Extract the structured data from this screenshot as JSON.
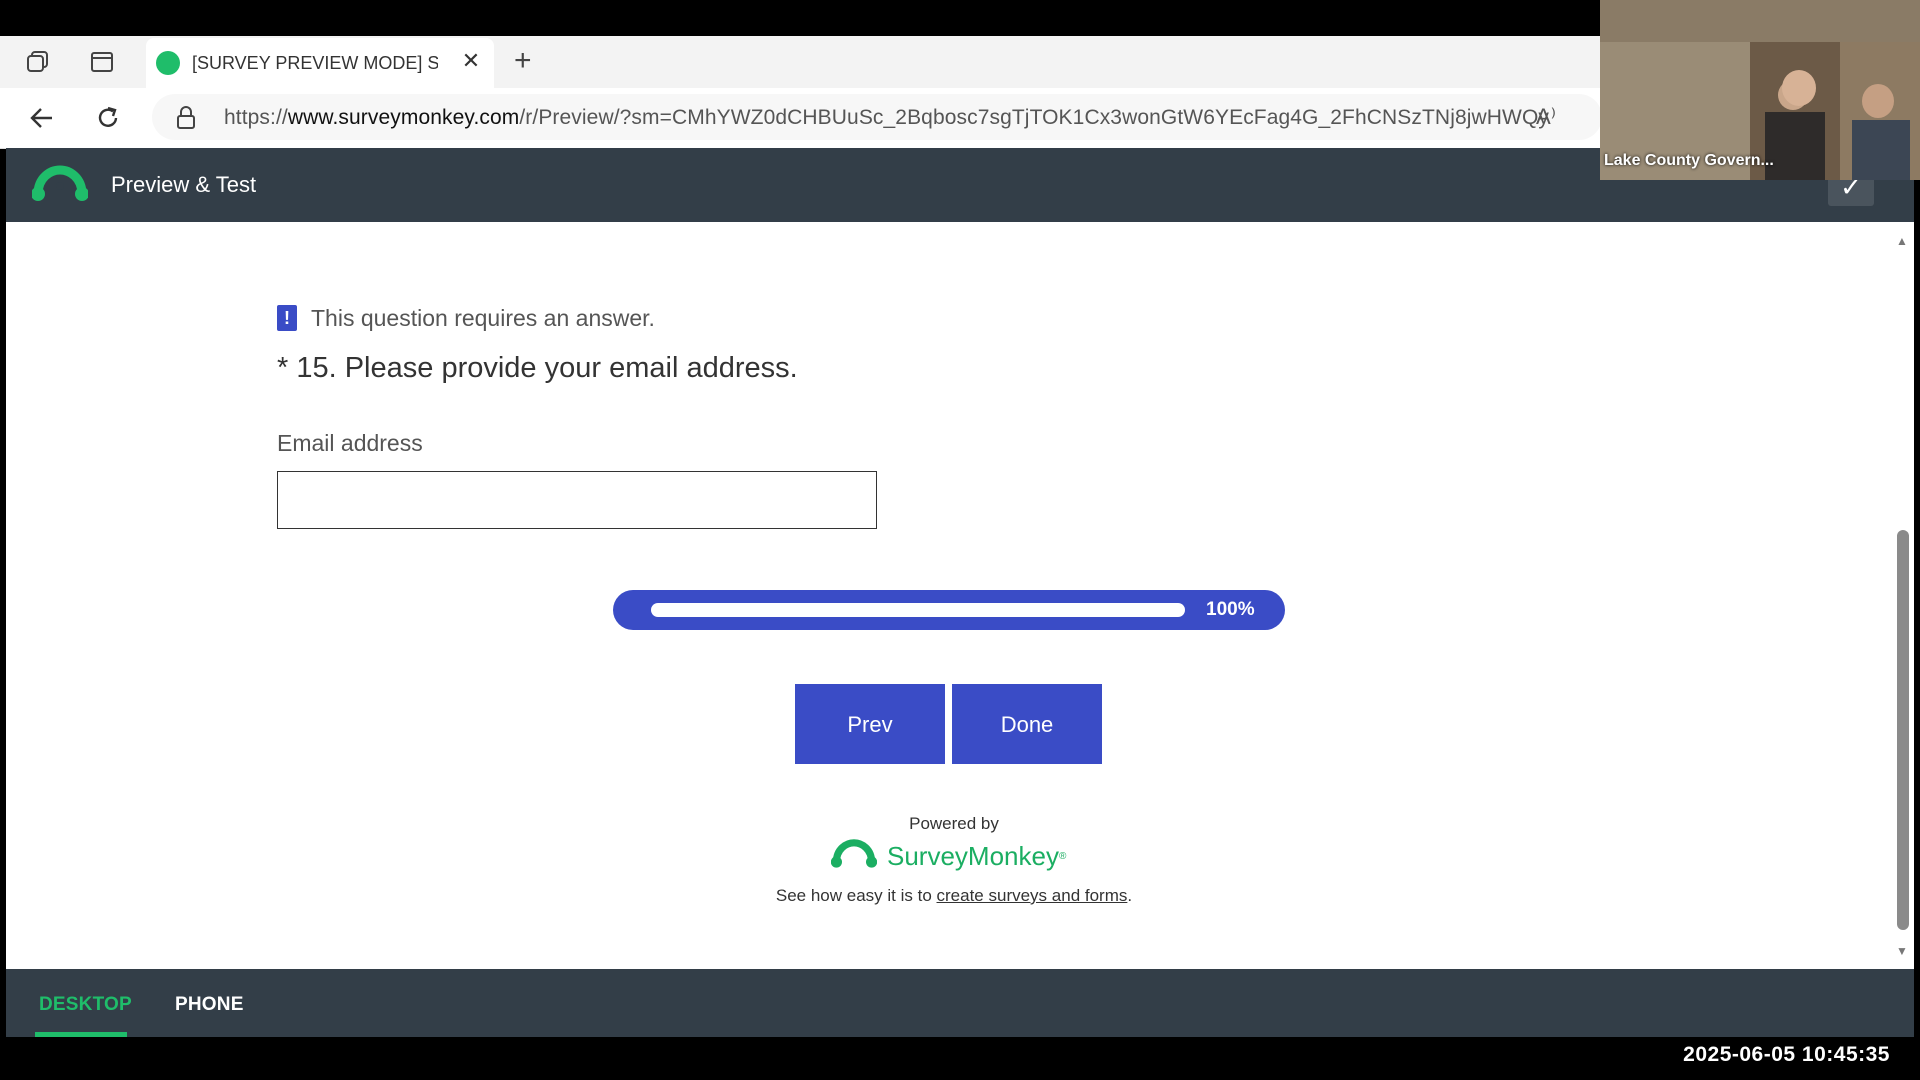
{
  "browser": {
    "tab_title": "[SURVEY PREVIEW MODE] Share",
    "url_prefix": "https://",
    "url_host": "www.surveymonkey.com",
    "url_path": "/r/Preview/?sm=CMhYWZ0dCHBUuSc_2Bqbosc7sgTjTOK1Cx3wonGtW6YEcFag4G_2FhCNSzTNj8jwHWQy",
    "read_aloud_label": "A⁾"
  },
  "header": {
    "title": "Preview & Test"
  },
  "question": {
    "required_notice": "This question requires an answer.",
    "required_badge": "!",
    "title": "* 15. Please provide your email address.",
    "field_label": "Email address",
    "field_value": ""
  },
  "progress": {
    "label": "100%",
    "value": 1.0
  },
  "buttons": {
    "prev": "Prev",
    "done": "Done"
  },
  "branding": {
    "powered_by": "Powered by",
    "brand_name": "SurveyMonkey",
    "brand_mark": "®",
    "promo_prefix": "See how easy it is to ",
    "promo_link": "create surveys and forms",
    "promo_suffix": "."
  },
  "footer": {
    "tabs": [
      {
        "label": "DESKTOP",
        "active": true
      },
      {
        "label": "PHONE",
        "active": false
      }
    ]
  },
  "video": {
    "participant_label": "Lake County Govern..."
  },
  "timestamp": "2025-06-05  10:45:35",
  "colors": {
    "accent": "#3a4cc6",
    "brand_green": "#1fbd6a",
    "header_bg": "#333e48"
  }
}
